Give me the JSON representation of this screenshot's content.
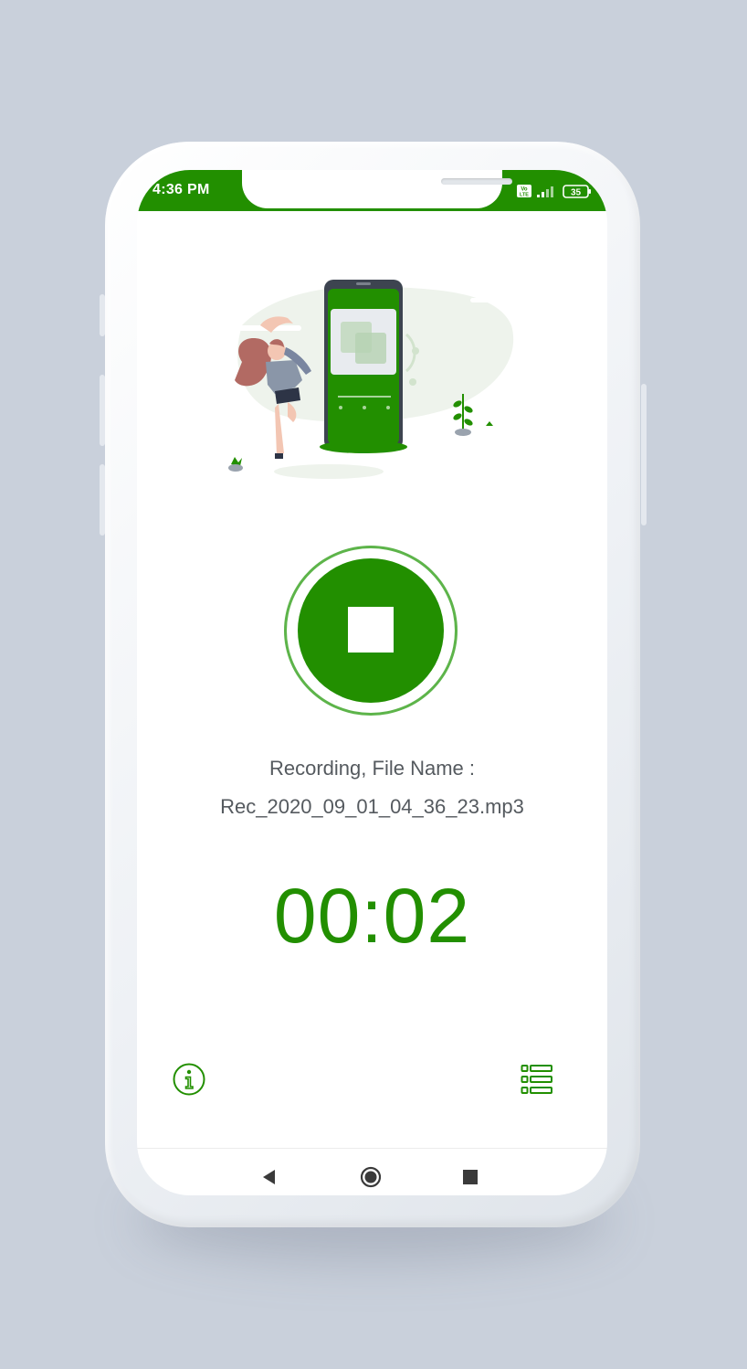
{
  "status_bar": {
    "time": "4:36 PM",
    "network_badge": "Vo LTE",
    "battery_level": "35",
    "signal-icon": "cell-signal",
    "accent_color": "#228f00"
  },
  "recorder": {
    "state_label": "Recording, File Name :",
    "file_name": "Rec_2020_09_01_04_36_23.mp3",
    "elapsed_time": "00:02",
    "primary_action_icon": "stop-icon"
  },
  "bottom_actions": {
    "left_icon": "info-icon",
    "right_icon": "list-icon"
  },
  "navigation": {
    "back_icon": "back-triangle-icon",
    "home_icon": "home-circle-icon",
    "recents_icon": "recents-square-icon"
  },
  "colors": {
    "brand_green": "#228f00",
    "ring_green": "#5db44a",
    "text_gray": "#555a5f"
  }
}
